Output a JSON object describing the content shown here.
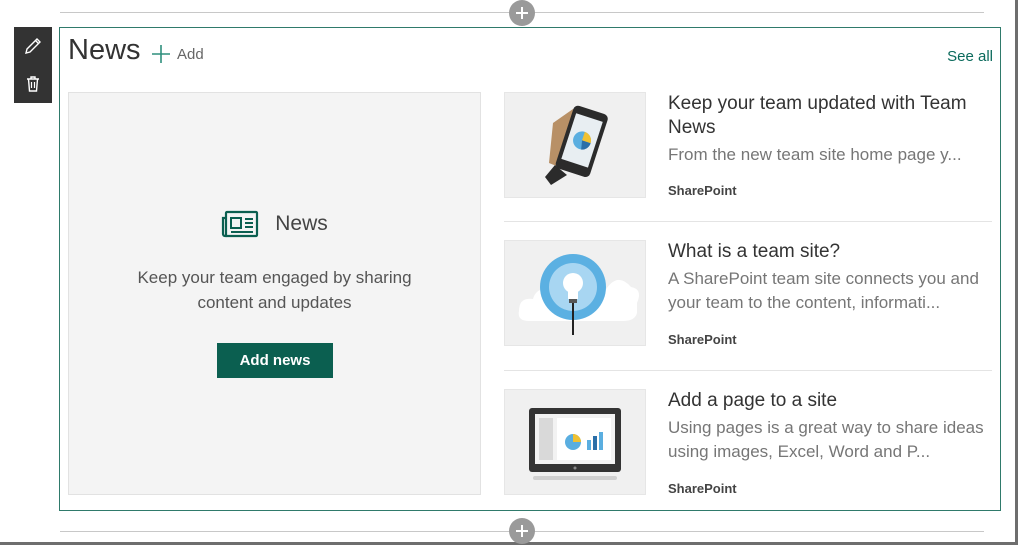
{
  "webpart": {
    "title": "News",
    "add_label": "Add",
    "see_all_label": "See all"
  },
  "toolbar": {
    "edit_icon": "pencil-icon",
    "delete_icon": "trash-icon"
  },
  "placeholder": {
    "heading": "News",
    "icon": "newspaper-icon",
    "description_line1": "Keep your team engaged by sharing",
    "description_line2": "content and updates",
    "button_label": "Add news"
  },
  "news_items": [
    {
      "title_line1": "Keep your team updated with Team",
      "title_line2": "News",
      "desc_line1": "From the new team site home page y...",
      "desc_line2": "",
      "source": "SharePoint",
      "thumbnail": "phone-chart-image"
    },
    {
      "title_line1": "What is a team site?",
      "title_line2": "",
      "desc_line1": "A SharePoint team site connects you and",
      "desc_line2": "your team to the content, informati...",
      "source": "SharePoint",
      "thumbnail": "lightbulb-cloud-image"
    },
    {
      "title_line1": "Add a page to a site",
      "title_line2": "",
      "desc_line1": "Using pages is a great way to share ideas",
      "desc_line2": "using images, Excel, Word and P...",
      "source": "SharePoint",
      "thumbnail": "tablet-chart-image"
    }
  ],
  "colors": {
    "accent": "#0b5f50",
    "link": "#0b6a5c",
    "border": "#2f7a6b",
    "toolbar": "#333333"
  }
}
